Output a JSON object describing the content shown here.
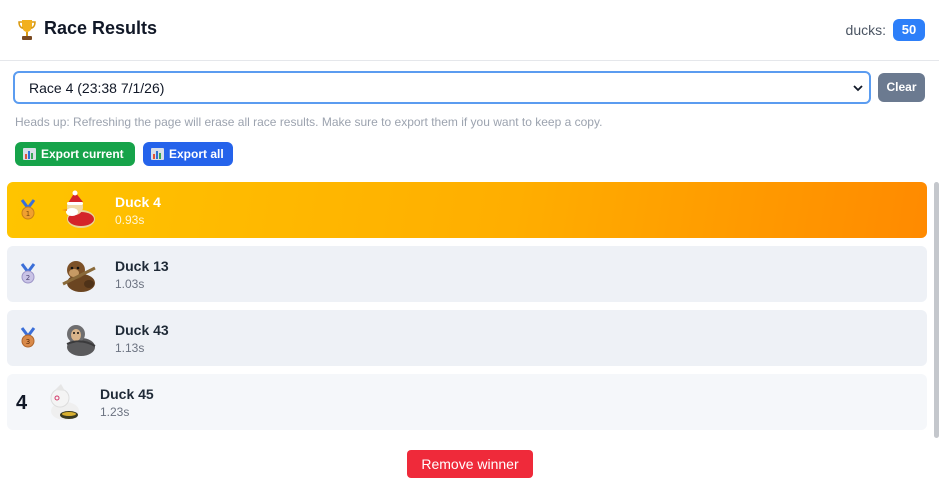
{
  "header": {
    "title": "Race Results",
    "ducks_label": "ducks:",
    "ducks_count": "50",
    "trophy_icon": "trophy-icon"
  },
  "race_select": {
    "selected": "Race 4 (23:38 7/1/26)"
  },
  "clear_label": "Clear",
  "notice": "Heads up: Refreshing the page will erase all race results. Make sure to export them if you want to keep a copy.",
  "export": {
    "current_label": "Export current",
    "all_label": "Export all",
    "icon": "bar-chart-icon"
  },
  "results": [
    {
      "rank": "1",
      "name": "Duck 4",
      "time": "0.93s",
      "medal": "gold"
    },
    {
      "rank": "2",
      "name": "Duck 13",
      "time": "1.03s",
      "medal": "silver"
    },
    {
      "rank": "3",
      "name": "Duck 43",
      "time": "1.13s",
      "medal": "bronze"
    },
    {
      "rank": "4",
      "name": "Duck 45",
      "time": "1.23s",
      "medal": ""
    }
  ],
  "remove_winner_label": "Remove winner",
  "colors": {
    "accent_blue": "#2d7ff9",
    "first_place_start": "#ffc400",
    "first_place_end": "#ff8a00",
    "export_current": "#16a34a",
    "export_all": "#2563eb",
    "remove": "#ef2a3a",
    "clear": "#6b7a90"
  }
}
